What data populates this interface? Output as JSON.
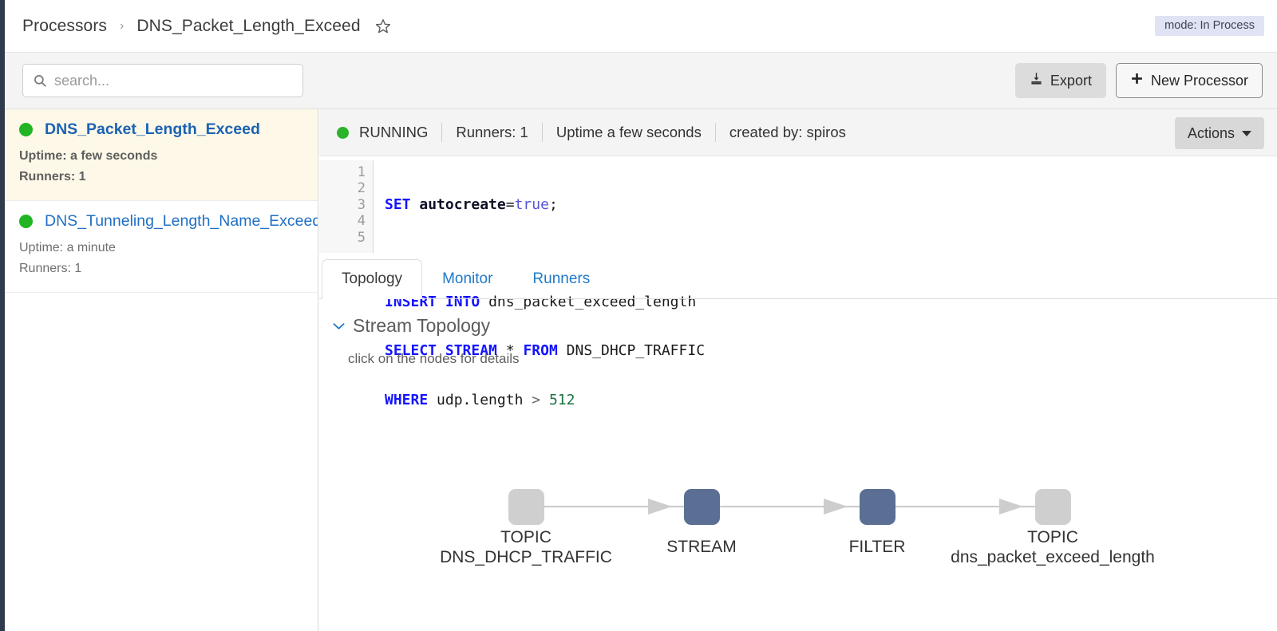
{
  "breadcrumb": {
    "root": "Processors",
    "separator": "›",
    "current": "DNS_Packet_Length_Exceed",
    "star_icon": "star-outline-icon"
  },
  "mode_badge": "mode: In Process",
  "toolbar": {
    "search_placeholder": "search...",
    "search_value": "",
    "search_icon": "search-icon",
    "export_label": "Export",
    "export_icon": "download-icon",
    "new_processor_label": "New Processor",
    "new_processor_icon": "plus-icon"
  },
  "sidebar": {
    "items": [
      {
        "name": "DNS_Packet_Length_Exceed",
        "uptime": "Uptime: a few seconds",
        "runners": "Runners: 1",
        "status_color": "#22b523",
        "selected": true
      },
      {
        "name": "DNS_Tunneling_Length_Name_Exceed",
        "uptime": "Uptime: a minute",
        "runners": "Runners: 1",
        "status_color": "#22b523",
        "selected": false
      }
    ]
  },
  "detail": {
    "status": {
      "state": "RUNNING",
      "runners": "Runners: 1",
      "uptime": "Uptime a few seconds",
      "created_by": "created by: spiros",
      "state_color": "#2bb42b"
    },
    "actions_label": "Actions",
    "code": {
      "line_numbers": [
        "1",
        "2",
        "3",
        "4",
        "5"
      ],
      "lines": [
        "SET autocreate=true;",
        "",
        "INSERT INTO dns_packet_exceed_length",
        "SELECT STREAM * FROM DNS_DHCP_TRAFFIC",
        "WHERE udp.length > 512"
      ]
    },
    "tabs": [
      {
        "label": "Topology",
        "active": true
      },
      {
        "label": "Monitor",
        "active": false
      },
      {
        "label": "Runners",
        "active": false
      }
    ],
    "topology": {
      "section_title": "Stream Topology",
      "chevron_icon": "chevron-down-icon",
      "hint": "click on the nodes for details",
      "nodes": [
        {
          "type": "TOPIC",
          "label": "DNS_DHCP_TRAFFIC",
          "color": "#cfcfcf"
        },
        {
          "type": "STREAM",
          "label": "",
          "color": "#5b6e93"
        },
        {
          "type": "FILTER",
          "label": "",
          "color": "#5b6e93"
        },
        {
          "type": "TOPIC",
          "label": "dns_packet_exceed_length",
          "color": "#cfcfcf"
        }
      ]
    }
  },
  "colors": {
    "accent_blue": "#2079c8",
    "selected_row": "#fdf8e7",
    "badge_bg": "#dfe3f3",
    "node_active": "#5b6e93",
    "node_idle": "#cfcfcf"
  }
}
